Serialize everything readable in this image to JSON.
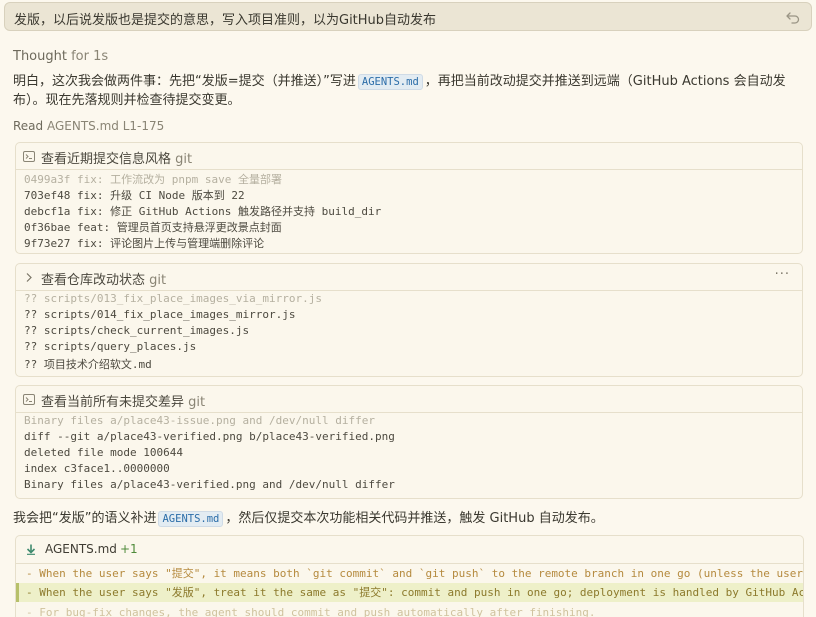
{
  "prompt": {
    "text": "发版，以后说发版也是提交的意思，写入项目准则，以为GitHub自动发布"
  },
  "thought": {
    "label": "Thought",
    "duration": "for 1s"
  },
  "para1": {
    "before": "明白，这次我会做两件事：先把“发版=提交（并推送）”写进",
    "chip": "AGENTS.md",
    "after": "，再把当前改动提交并推送到远端（GitHub Actions 会自动发布）。现在先落规则并检查待提交变更。"
  },
  "read": {
    "label": "Read",
    "target": "AGENTS.md L1-175"
  },
  "card1": {
    "title": "查看近期提交信息风格",
    "tool": "git",
    "lines": [
      "0499a3f fix: 工作流改为 pnpm save 全量部署",
      "703ef48 fix: 升级 CI Node 版本到 22",
      "debcf1a fix: 修正 GitHub Actions 触发路径并支持 build_dir",
      "0f36bae feat: 管理员首页支持悬浮更改景点封面",
      "9f73e27 fix: 评论图片上传与管理端删除评论"
    ]
  },
  "card2": {
    "title": "查看仓库改动状态",
    "tool": "git",
    "more": "···",
    "lines": [
      "?? scripts/013_fix_place_images_via_mirror.js",
      "?? scripts/014_fix_place_images_mirror.js",
      "?? scripts/check_current_images.js",
      "?? scripts/query_places.js",
      "?? 项目技术介绍软文.md"
    ]
  },
  "card3": {
    "title": "查看当前所有未提交差异",
    "tool": "git",
    "lines": [
      "Binary files a/place43-issue.png and /dev/null differ",
      "diff --git a/place43-verified.png b/place43-verified.png",
      "deleted file mode 100644",
      "index c3face1..0000000",
      "Binary files a/place43-verified.png and /dev/null differ"
    ]
  },
  "para2": {
    "before": "我会把“发版”的语义补进",
    "chip": "AGENTS.md",
    "after": "，然后仅提交本次功能相关代码并推送，触发 GitHub 自动发布。"
  },
  "diff": {
    "file": "AGENTS.md",
    "added": "+1",
    "lines": [
      "- When the user says \"提交\", it means both `git commit` and `git push` to the remote branch in one go (unless the user",
      "- When the user says \"发版\", treat it the same as \"提交\": commit and push in one go; deployment is handled by GitHub Ac",
      "- For bug-fix changes, the agent should commit and push automatically after finishing."
    ]
  },
  "colors": {
    "background": "#fcf8ee",
    "code_chip": "#2b6da8",
    "added_line": "#eef0c9",
    "added_count": "#4e8a3a"
  }
}
